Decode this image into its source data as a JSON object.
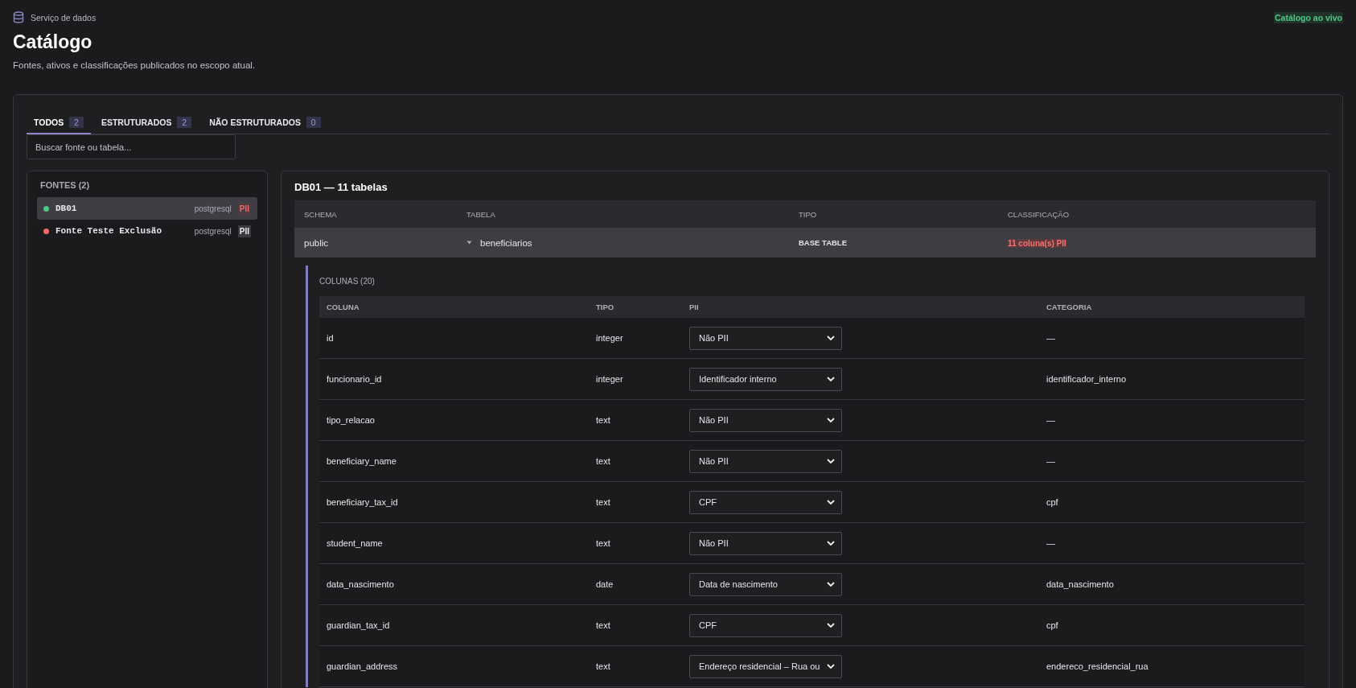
{
  "header": {
    "service": "Serviço de dados",
    "title": "Catálogo",
    "subtitle": "Fontes, ativos e classificações publicados no escopo atual.",
    "live_badge": "Catálogo ao vivo"
  },
  "tabs": [
    {
      "label": "TODOS",
      "count": "2",
      "selected": true
    },
    {
      "label": "ESTRUTURADOS",
      "count": "2",
      "selected": false
    },
    {
      "label": "NÃO ESTRUTURADOS",
      "count": "0",
      "selected": false
    }
  ],
  "search": {
    "placeholder": "Buscar fonte ou tabela..."
  },
  "sources": {
    "title": "FONTES (2)",
    "items": [
      {
        "name": "DB01",
        "engine": "postgresql",
        "badge": "PII",
        "color": "#4fc785",
        "pii_flagged": true,
        "selected": true
      },
      {
        "name": "Fonte Teste Exclusão",
        "engine": "postgresql",
        "badge": "PII",
        "color": "#f06a6a",
        "pii_flagged": false,
        "selected": false
      }
    ]
  },
  "detail": {
    "title": "DB01 — 11 tabelas",
    "table": {
      "columns": [
        "SCHEMA",
        "TABELA",
        "TIPO",
        "CLASSIFICAÇÃO"
      ],
      "rows": [
        {
          "schema": "public",
          "table": "beneficiarios",
          "expanded": true,
          "type": "BASE TABLE",
          "classification": "11 coluna(s) PII"
        }
      ]
    },
    "columns_panel": {
      "title": "COLUNAS (20)",
      "columns": [
        "COLUNA",
        "TIPO",
        "PII",
        "CATEGORIA"
      ],
      "rows": [
        {
          "name": "id",
          "type": "integer",
          "pii": "Não PII",
          "category": "—"
        },
        {
          "name": "funcionario_id",
          "type": "integer",
          "pii": "Identificador interno",
          "category": "identificador_interno"
        },
        {
          "name": "tipo_relacao",
          "type": "text",
          "pii": "Não PII",
          "category": "—"
        },
        {
          "name": "beneficiary_name",
          "type": "text",
          "pii": "Não PII",
          "category": "—"
        },
        {
          "name": "beneficiary_tax_id",
          "type": "text",
          "pii": "CPF",
          "category": "cpf"
        },
        {
          "name": "student_name",
          "type": "text",
          "pii": "Não PII",
          "category": "—"
        },
        {
          "name": "data_nascimento",
          "type": "date",
          "pii": "Data de nascimento",
          "category": "data_nascimento"
        },
        {
          "name": "guardian_tax_id",
          "type": "text",
          "pii": "CPF",
          "category": "cpf"
        },
        {
          "name": "guardian_address",
          "type": "text",
          "pii": "Endereço residencial – Rua ou",
          "category": "endereco_residencial_rua"
        }
      ]
    }
  }
}
